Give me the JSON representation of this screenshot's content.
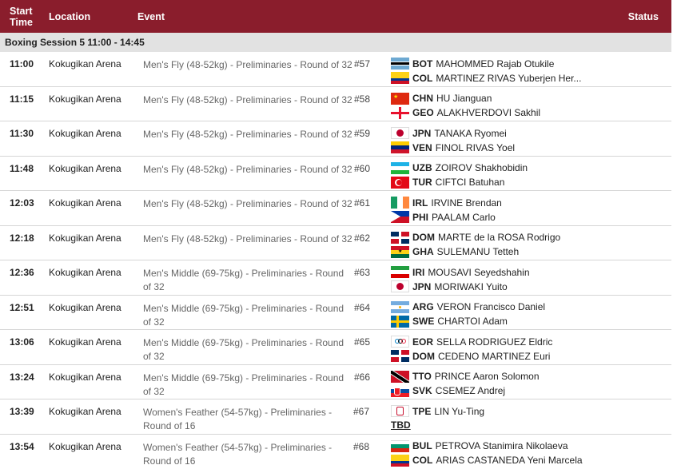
{
  "header": {
    "time": "Start Time",
    "location": "Location",
    "event": "Event",
    "status": "Status"
  },
  "session": "Boxing Session 5  11:00 - 14:45",
  "rows": [
    {
      "time": "11:00",
      "location": "Kokugikan Arena",
      "event": "Men's Fly (48-52kg) - Preliminaries - Round of 32",
      "num": "#57",
      "a1": {
        "code": "BOT",
        "name": "MAHOMMED Rajab Otukile"
      },
      "a2": {
        "code": "COL",
        "name": "MARTINEZ RIVAS Yuberjen Her..."
      }
    },
    {
      "time": "11:15",
      "location": "Kokugikan Arena",
      "event": "Men's Fly (48-52kg) - Preliminaries - Round of 32",
      "num": "#58",
      "a1": {
        "code": "CHN",
        "name": "HU Jianguan"
      },
      "a2": {
        "code": "GEO",
        "name": "ALAKHVERDOVI Sakhil"
      }
    },
    {
      "time": "11:30",
      "location": "Kokugikan Arena",
      "event": "Men's Fly (48-52kg) - Preliminaries - Round of 32",
      "num": "#59",
      "a1": {
        "code": "JPN",
        "name": "TANAKA Ryomei"
      },
      "a2": {
        "code": "VEN",
        "name": "FINOL RIVAS Yoel"
      }
    },
    {
      "time": "11:48",
      "location": "Kokugikan Arena",
      "event": "Men's Fly (48-52kg) - Preliminaries - Round of 32",
      "num": "#60",
      "a1": {
        "code": "UZB",
        "name": "ZOIROV Shakhobidin"
      },
      "a2": {
        "code": "TUR",
        "name": "CIFTCI Batuhan"
      }
    },
    {
      "time": "12:03",
      "location": "Kokugikan Arena",
      "event": "Men's Fly (48-52kg) - Preliminaries - Round of 32",
      "num": "#61",
      "a1": {
        "code": "IRL",
        "name": "IRVINE Brendan"
      },
      "a2": {
        "code": "PHI",
        "name": "PAALAM Carlo"
      }
    },
    {
      "time": "12:18",
      "location": "Kokugikan Arena",
      "event": "Men's Fly (48-52kg) - Preliminaries - Round of 32",
      "num": "#62",
      "a1": {
        "code": "DOM",
        "name": "MARTE de la ROSA Rodrigo"
      },
      "a2": {
        "code": "GHA",
        "name": "SULEMANU Tetteh"
      }
    },
    {
      "time": "12:36",
      "location": "Kokugikan Arena",
      "event": "Men's Middle (69-75kg) - Preliminaries - Round of 32",
      "num": "#63",
      "a1": {
        "code": "IRI",
        "name": "MOUSAVI Seyedshahin"
      },
      "a2": {
        "code": "JPN",
        "name": "MORIWAKI Yuito"
      }
    },
    {
      "time": "12:51",
      "location": "Kokugikan Arena",
      "event": "Men's Middle (69-75kg) - Preliminaries - Round of 32",
      "num": "#64",
      "a1": {
        "code": "ARG",
        "name": "VERON Francisco Daniel"
      },
      "a2": {
        "code": "SWE",
        "name": "CHARTOI Adam"
      }
    },
    {
      "time": "13:06",
      "location": "Kokugikan Arena",
      "event": "Men's Middle (69-75kg) - Preliminaries - Round of 32",
      "num": "#65",
      "a1": {
        "code": "EOR",
        "name": "SELLA RODRIGUEZ Eldric"
      },
      "a2": {
        "code": "DOM",
        "name": "CEDENO MARTINEZ Euri"
      }
    },
    {
      "time": "13:24",
      "location": "Kokugikan Arena",
      "event": "Men's Middle (69-75kg) - Preliminaries - Round of 32",
      "num": "#66",
      "a1": {
        "code": "TTO",
        "name": "PRINCE Aaron Solomon"
      },
      "a2": {
        "code": "SVK",
        "name": "CSEMEZ Andrej"
      }
    },
    {
      "time": "13:39",
      "location": "Kokugikan Arena",
      "event": "Women's Feather (54-57kg) - Preliminaries - Round of 16",
      "num": "#67",
      "a1": {
        "code": "TPE",
        "name": "LIN Yu-Ting"
      },
      "a2": {
        "code": "",
        "name": ""
      },
      "tbd": "TBD"
    },
    {
      "time": "13:54",
      "location": "Kokugikan Arena",
      "event": "Women's Feather (54-57kg) - Preliminaries - Round of 16",
      "num": "#68",
      "a1": {
        "code": "BUL",
        "name": "PETROVA Stanimira Nikolaeva"
      },
      "a2": {
        "code": "COL",
        "name": "ARIAS CASTANEDA Yeni Marcela"
      }
    }
  ],
  "colors": {
    "header": "#8a1d2c",
    "session_bg": "#e2e2e2"
  }
}
